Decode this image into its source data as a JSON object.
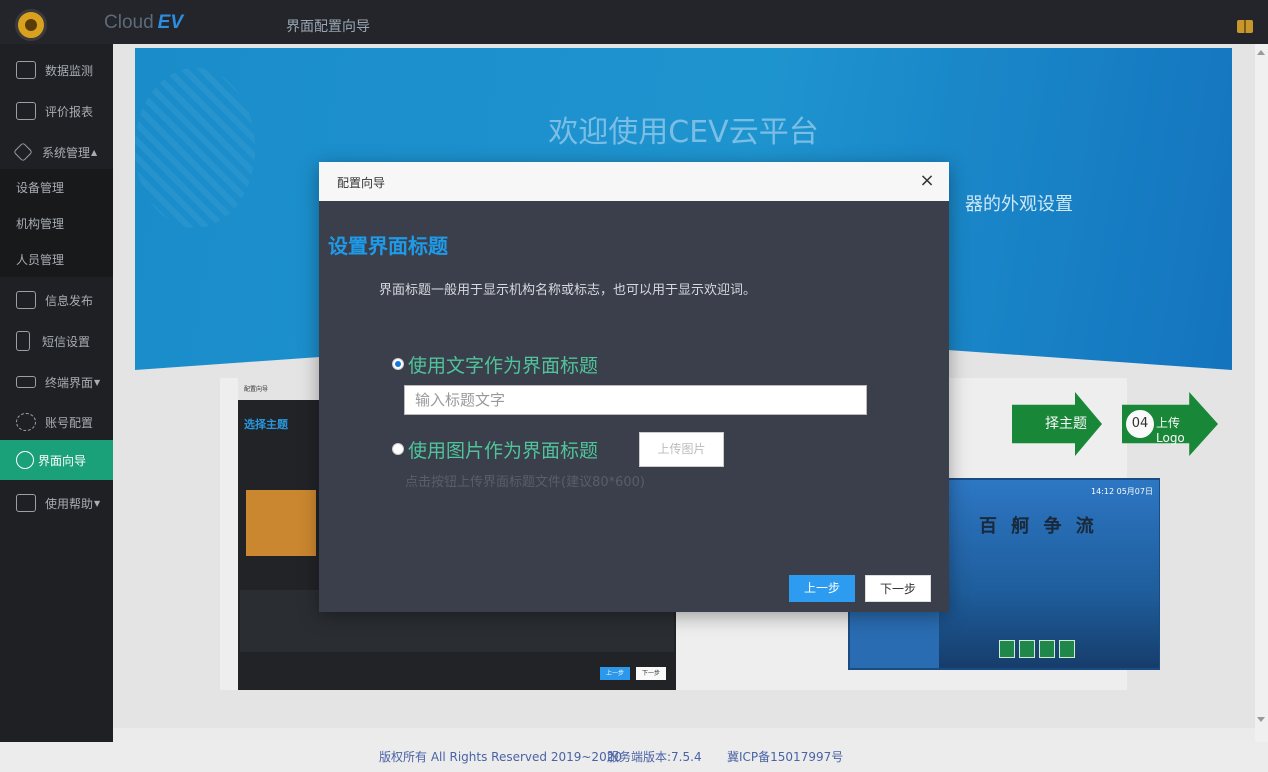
{
  "topbar": {
    "brand_prefix": "Cloud",
    "brand_suffix": "EV",
    "page_title": "界面配置向导"
  },
  "sidebar": {
    "items": [
      {
        "label": "数据监测",
        "icon": "video-play-icon"
      },
      {
        "label": "评价报表",
        "icon": "clipboard-icon"
      },
      {
        "label": "系统管理",
        "icon": "diamond-icon",
        "caret": "▲"
      },
      {
        "label": "设备管理"
      },
      {
        "label": "机构管理"
      },
      {
        "label": "人员管理"
      },
      {
        "label": "信息发布",
        "icon": "image-icon"
      },
      {
        "label": "短信设置",
        "icon": "phone-icon"
      },
      {
        "label": "终端界面",
        "icon": "window-icon",
        "caret": "▼"
      },
      {
        "label": "账号配置",
        "icon": "gear-icon"
      },
      {
        "label": "界面向导",
        "icon": "check-circle-icon"
      },
      {
        "label": "使用帮助",
        "icon": "help-icon",
        "caret": "▼"
      }
    ]
  },
  "banner": {
    "title": "欢迎使用CEV云平台",
    "subtitle": "器的外观设置"
  },
  "preview": {
    "mini_header": "配置向导",
    "mini_title": "选择主题",
    "mini_prev": "上一步",
    "mini_next": "下一步",
    "step3_label": "择主题",
    "step4_num": "04",
    "step4_label": "上传Logo",
    "clock": "14:12 05月07日",
    "calligraphy": "百 舸 争 流"
  },
  "dialog": {
    "header_title": "配置向导",
    "close_glyph": "×",
    "heading": "设置界面标题",
    "description": "界面标题一般用于显示机构名称或标志，也可以用于显示欢迎词。",
    "option_text_label": "使用文字作为界面标题",
    "option_text_checked": true,
    "title_input_placeholder": "输入标题文字",
    "title_input_value": "",
    "option_image_label": "使用图片作为界面标题",
    "option_image_checked": false,
    "upload_button": "上传图片",
    "upload_hint": "点击按钮上传界面标题文件(建议80*600)",
    "prev_button": "上一步",
    "next_button": "下一步"
  },
  "footer": {
    "copyright": "版权所有 All Rights Reserved 2019~2020",
    "version": "服务端版本:7.5.4",
    "icp": "冀ICP备15017997号"
  },
  "colors": {
    "topbar_bg": "#23252a",
    "sidebar_bg": "#1e2023",
    "sidebar_active": "#1aa179",
    "dialog_bg": "#3b3e4b",
    "heading_blue": "#1e9be8",
    "option_green": "#4fc49a",
    "primary_button": "#2d9cf0"
  }
}
